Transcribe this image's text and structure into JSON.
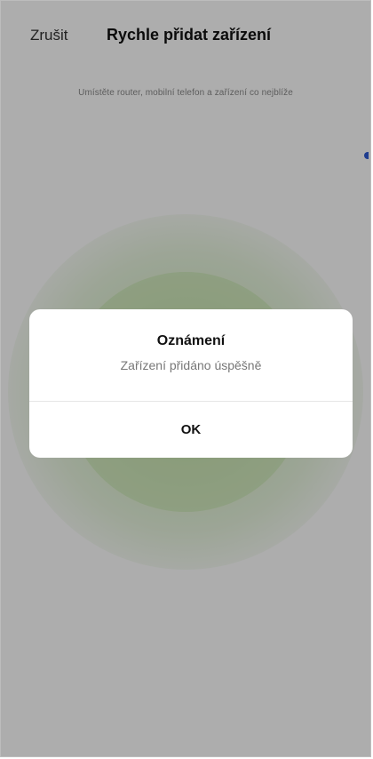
{
  "header": {
    "cancel_label": "Zrušit",
    "title": "Rychle přidat zařízení"
  },
  "main": {
    "hint": "Umístěte router, mobilní telefon a zařízení co nejblíže"
  },
  "dialog": {
    "title": "Oznámení",
    "message": "Zařízení přidáno úspěšně",
    "ok_label": "OK"
  },
  "colors": {
    "accent_green": "#7ec04a",
    "edge_indicator": "#2f5bd3"
  }
}
